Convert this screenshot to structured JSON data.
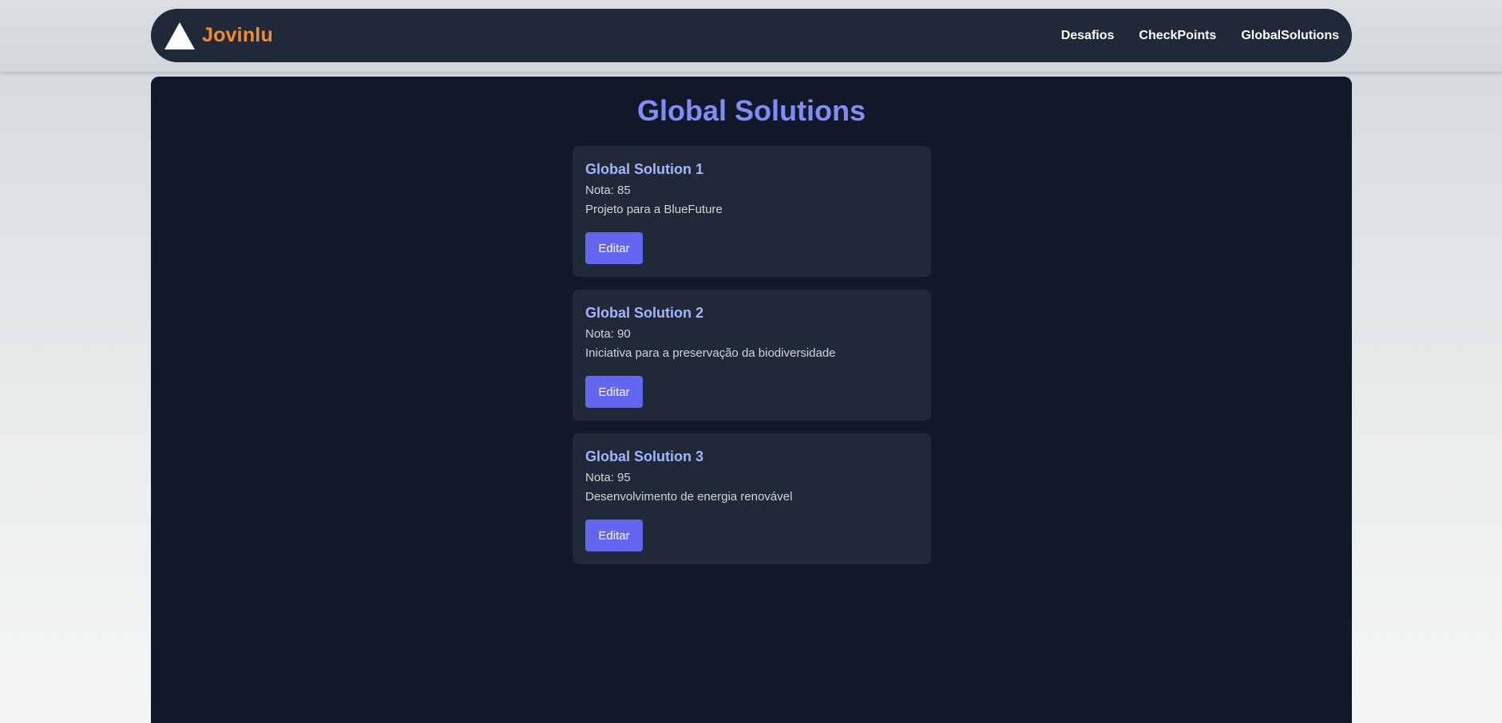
{
  "colors": {
    "navbar_bg": "#1f2937",
    "brand": "#f28b30",
    "panel_bg": "#111827",
    "card_bg": "#1f2937",
    "title": "#818cf8",
    "card_title": "#a5b4fc",
    "button": "#6366f1"
  },
  "header": {
    "logo_icon": "triangle-logo-icon",
    "brand": "Jovinlu",
    "nav": [
      {
        "label": "Desafios"
      },
      {
        "label": "CheckPoints"
      },
      {
        "label": "GlobalSolutions"
      }
    ]
  },
  "main": {
    "title": "Global Solutions",
    "grade_label": "Nota:",
    "cards": [
      {
        "title": "Global Solution 1",
        "grade": "85",
        "description": "Projeto para a BlueFuture",
        "button": "Editar"
      },
      {
        "title": "Global Solution 2",
        "grade": "90",
        "description": "Iniciativa para a preservação da biodiversidade",
        "button": "Editar"
      },
      {
        "title": "Global Solution 3",
        "grade": "95",
        "description": "Desenvolvimento de energia renovável",
        "button": "Editar"
      }
    ]
  }
}
